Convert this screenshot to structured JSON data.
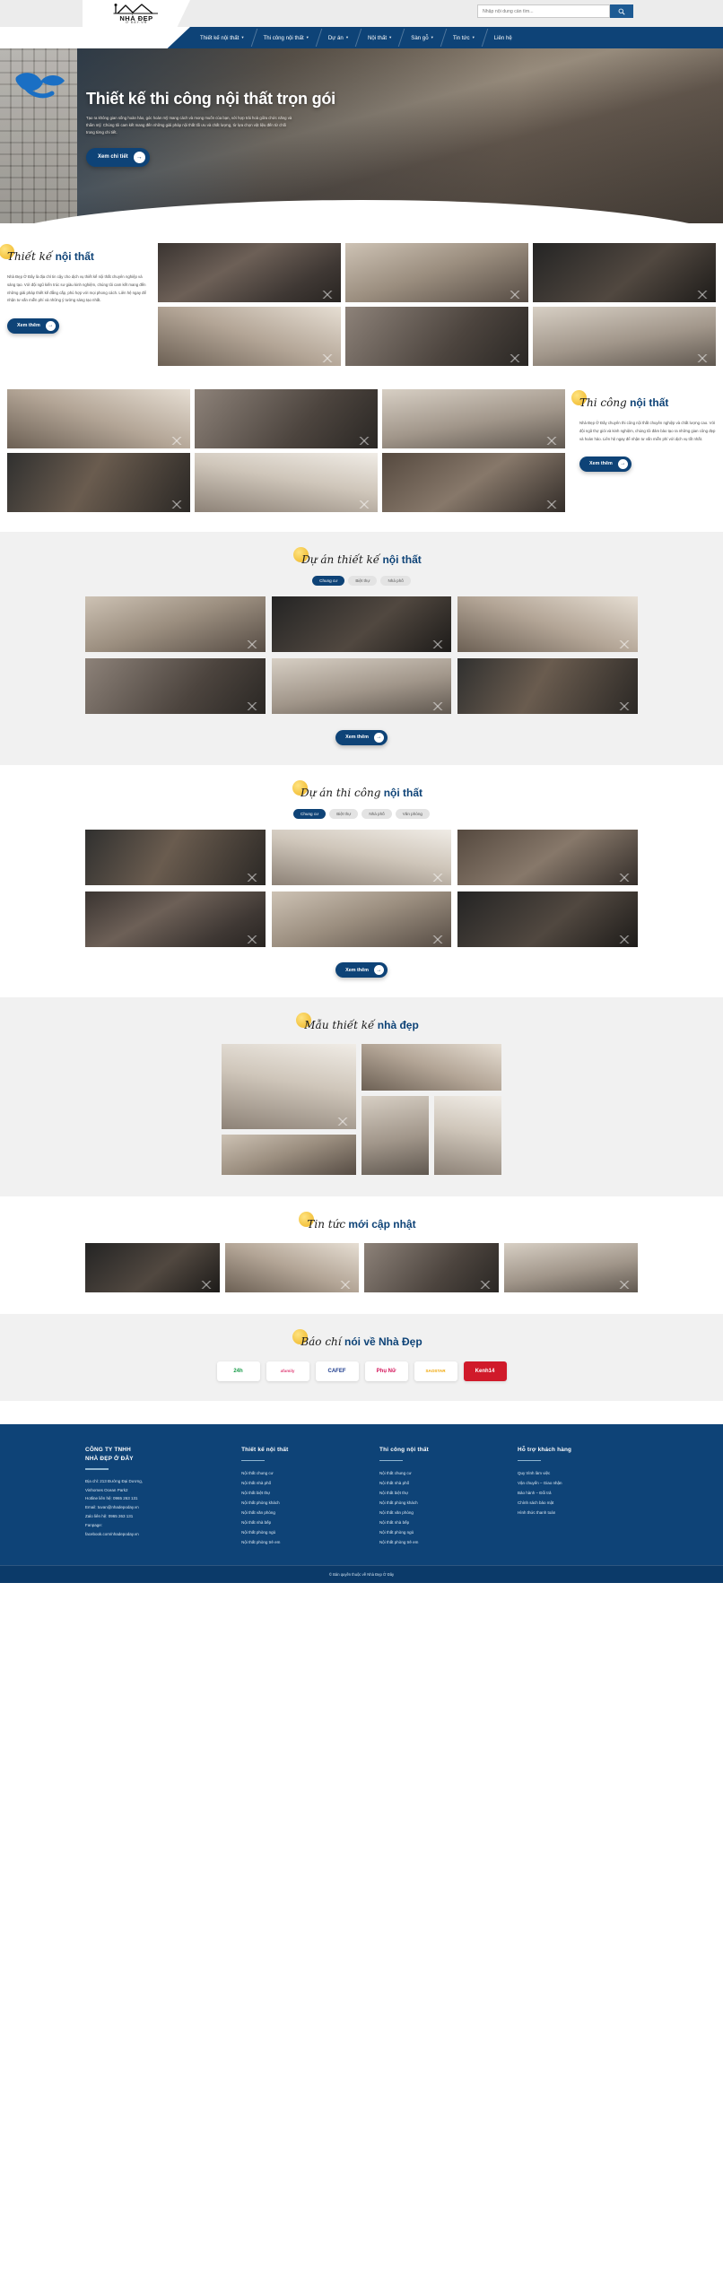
{
  "brand": {
    "logo_text": "NHÀ ĐẸP",
    "logo_sub": "Ở ĐÂY.VN"
  },
  "search": {
    "placeholder": "Nhập nội dung cần tìm...",
    "icon": "search-icon"
  },
  "nav": {
    "items": [
      {
        "label": "Thiết kế nội thất",
        "caret": "▾"
      },
      {
        "label": "Thi công nội thất",
        "caret": "▾"
      },
      {
        "label": "Dự án",
        "caret": "▾"
      },
      {
        "label": "Nội thất",
        "caret": "▾"
      },
      {
        "label": "Sàn gỗ",
        "caret": "▾"
      },
      {
        "label": "Tin tức",
        "caret": "▾"
      },
      {
        "label": "Liên hệ",
        "caret": ""
      }
    ]
  },
  "hero": {
    "title": "Thiết kế thi công nội thất trọn gói",
    "desc": "Tạo ra không gian sống hoàn hảo, góc hoàn mỹ mang cách và mong muốn của bạn, với hợp trải hoà giữa chức năng và thẩm mỹ. Chúng tôi cam kết mang đến những giải pháp nội thất tối ưu và chất lượng, từ lựa chọn vật liệu đến từ chối trong từng chi tiết.",
    "cta": "Xem chi tiết",
    "cta_icon": "arrow-right-icon"
  },
  "section_design": {
    "headline_script": "Thiết kế",
    "headline_bold": "nội thất",
    "body": "Nhà Đẹp Ở Đây là địa chỉ tin cậy cho dịch vụ thiết kế nội thất chuyên nghiệp và sáng tạo. Với đội ngũ kiến trúc sư giàu kinh nghiệm, chúng tôi cam kết mang đến những giải pháp thiết kế đẳng cấp, phù hợp với mọi phong cách. Liên hệ ngay để nhận tư vấn miễn phí và những ý tưởng sáng tạo nhất.",
    "cta": "Xem thêm",
    "cta_icon": "arrow-right-icon",
    "images": [
      {
        "name": "design-thumb-1"
      },
      {
        "name": "design-thumb-2"
      },
      {
        "name": "design-thumb-3"
      },
      {
        "name": "design-thumb-4"
      },
      {
        "name": "design-thumb-5"
      },
      {
        "name": "design-thumb-6"
      }
    ]
  },
  "section_build": {
    "headline_script": "Thi công",
    "headline_bold": "nội thất",
    "body": "Nhà Đẹp Ở Đây chuyên thi công nội thất chuyên nghiệp và chất lượng cao. Với đội ngũ thợ giỏi và kinh nghiệm, chúng tôi đảm bảo tạo ra những gian công đẹp và hoàn hảo. Liên hệ ngay để nhận tư vấn miễn phí với dịch vụ tốt nhất.",
    "cta": "Xem thêm",
    "cta_icon": "arrow-right-icon",
    "images": [
      {
        "name": "build-thumb-1"
      },
      {
        "name": "build-thumb-2"
      },
      {
        "name": "build-thumb-3"
      },
      {
        "name": "build-thumb-4"
      },
      {
        "name": "build-thumb-5"
      },
      {
        "name": "build-thumb-6"
      }
    ]
  },
  "section_projects_design": {
    "headline_script": "Dự án thiết kế",
    "headline_bold": "nội thất",
    "tabs": [
      {
        "label": "Chung cư",
        "active": true
      },
      {
        "label": "Biệt thự",
        "active": false
      },
      {
        "label": "Nhà phố",
        "active": false
      }
    ],
    "cta": "Xem thêm",
    "cta_icon": "arrow-right-icon",
    "images": [
      {
        "name": "project-design-1"
      },
      {
        "name": "project-design-2"
      },
      {
        "name": "project-design-3"
      },
      {
        "name": "project-design-4"
      },
      {
        "name": "project-design-5"
      },
      {
        "name": "project-design-6"
      }
    ]
  },
  "section_projects_build": {
    "headline_script": "Dự án thi công",
    "headline_bold": "nội thất",
    "tabs": [
      {
        "label": "Chung cư",
        "active": true
      },
      {
        "label": "Biệt thự",
        "active": false
      },
      {
        "label": "Nhà phố",
        "active": false
      },
      {
        "label": "Văn phòng",
        "active": false
      }
    ],
    "cta": "Xem thêm",
    "cta_icon": "arrow-right-icon",
    "images": [
      {
        "name": "project-build-1"
      },
      {
        "name": "project-build-2"
      },
      {
        "name": "project-build-3"
      },
      {
        "name": "project-build-4"
      },
      {
        "name": "project-build-5"
      },
      {
        "name": "project-build-6"
      }
    ]
  },
  "section_models": {
    "headline_script": "Mẫu thiết kế",
    "headline_bold": "nhà đẹp",
    "images": [
      {
        "name": "model-large-1"
      },
      {
        "name": "model-wide-2"
      },
      {
        "name": "model-tall-3"
      },
      {
        "name": "model-tall-4"
      },
      {
        "name": "model-wide-5"
      }
    ]
  },
  "section_news": {
    "headline_script": "Tin tức",
    "headline_bold": "mới cập nhật",
    "images": [
      {
        "name": "news-thumb-1"
      },
      {
        "name": "news-thumb-2"
      },
      {
        "name": "news-thumb-3"
      },
      {
        "name": "news-thumb-4"
      }
    ]
  },
  "section_press": {
    "headline_script": "Báo chí",
    "headline_bold": "nói về Nhà Đẹp",
    "logos": [
      {
        "name": "press-logo-24h",
        "label": "24h"
      },
      {
        "name": "press-logo-afamily",
        "label": "afamily"
      },
      {
        "name": "press-logo-cafef",
        "label": "CAFEF"
      },
      {
        "name": "press-logo-phunu",
        "label": "Phụ Nữ"
      },
      {
        "name": "press-logo-saostar",
        "label": "SAOSTAR"
      },
      {
        "name": "press-logo-kenh14",
        "label": "Kenh14"
      }
    ]
  },
  "footer": {
    "company": {
      "title_line1": "CÔNG TY TNHH",
      "title_line2": "NHÀ ĐẸP Ở ĐÂY",
      "lines": [
        "Địa chỉ: 213 Đường Đại Dương,",
        "Vinhomes Ocean Park2",
        "Hotline liên hệ: 0965 263 131",
        "Email: tuvan@nhadepoday.vn",
        "Zalo liên hệ: 0965 263 131",
        "Fanpage:",
        "facebook.com/nhadepoday.vn"
      ]
    },
    "col_design": {
      "title": "Thiết kế nội thất",
      "links": [
        "Nội thất chung cư",
        "Nội thất nhà phố",
        "Nội thất biệt thự",
        "Nội thất phòng khách",
        "Nội thất văn phòng",
        "Nội thất nhà bếp",
        "Nội thất phòng ngủ",
        "Nội thất phòng trẻ em"
      ]
    },
    "col_build": {
      "title": "Thi công nội thất",
      "links": [
        "Nội thất chung cư",
        "Nội thất nhà phố",
        "Nội thất biệt thự",
        "Nội thất phòng khách",
        "Nội thất văn phòng",
        "Nội thất nhà bếp",
        "Nội thất phòng ngủ",
        "Nội thất phòng trẻ em"
      ]
    },
    "col_support": {
      "title": "Hỗ trợ khách hàng",
      "links": [
        "Quy trình làm việc",
        "Vận chuyển – Giao nhận",
        "Bảo hành – Đổi trả",
        "Chính sách bảo mật",
        "Hình thức thanh toán"
      ]
    },
    "copyright": "© Bản quyền thuộc về Nhà Đẹp Ở Đây"
  }
}
